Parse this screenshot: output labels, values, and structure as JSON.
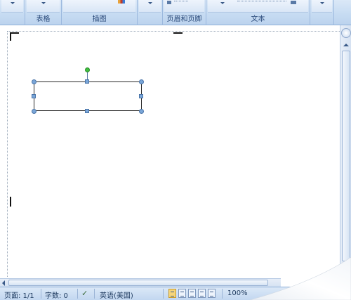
{
  "ribbon": {
    "groups": [
      {
        "label": "表格"
      },
      {
        "label": "插图"
      },
      {
        "label": "页眉和页脚"
      },
      {
        "label": "文本"
      }
    ]
  },
  "statusbar": {
    "page": "页面: 1/1",
    "words": "字数: 0",
    "language": "英语(美国)",
    "zoom": "100%"
  },
  "icons": {
    "spellcheck": "spellcheck-icon",
    "rotation": "rotation-handle",
    "scroll": "scroll-arrow-icon"
  },
  "colors": {
    "ribbon_bg": "#c6dbf2",
    "handle": "#7aa6d8",
    "rotation_handle": "#3fbf3f",
    "active_view": "#f6d57a"
  }
}
